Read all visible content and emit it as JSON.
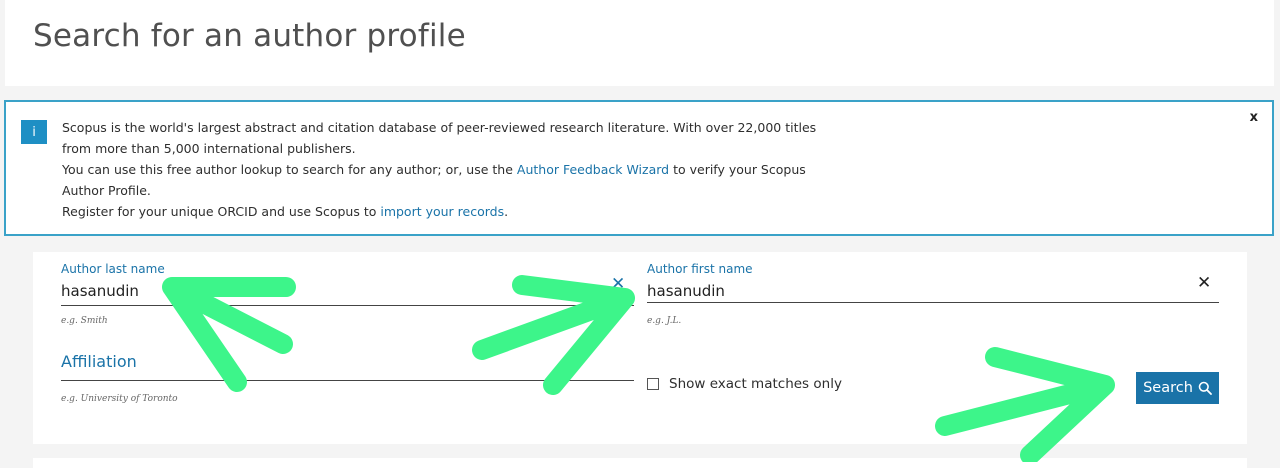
{
  "page": {
    "title": "Search for an author profile"
  },
  "info": {
    "icon": "info-icon",
    "icon_glyph": "i",
    "line1": "Scopus is the world's largest abstract and citation database of peer-reviewed research literature. With over 22,000 titles",
    "line2": "from more than 5,000 international publishers.",
    "line3_before": "You can use this free author lookup to search for any author; or, use the ",
    "line3_link": "Author Feedback Wizard",
    "line3_after": " to verify your Scopus",
    "line4": "Author Profile.",
    "line5_before": "Register for your unique ORCID and use Scopus to ",
    "line5_link": "import your records",
    "line5_after": ".",
    "close_glyph": "x"
  },
  "form": {
    "last_name": {
      "label": "Author last name",
      "value": "hasanudin",
      "hint": "e.g. Smith",
      "clear_glyph": "✕",
      "clear_color": "#1a73a8"
    },
    "first_name": {
      "label": "Author first name",
      "value": "hasanudin",
      "hint": "e.g. J.L.",
      "clear_glyph": "✕",
      "clear_color": "#222222"
    },
    "affiliation": {
      "label": "Affiliation",
      "value": "",
      "hint": "e.g. University of Toronto"
    },
    "exact_matches": {
      "label": "Show exact matches only",
      "checked": false
    },
    "search_button": {
      "label": "Search",
      "icon": "search-icon"
    }
  },
  "colors": {
    "accent": "#1a73a8",
    "info_border": "#3aa2c8",
    "annotation_arrow": "#3df58a"
  }
}
